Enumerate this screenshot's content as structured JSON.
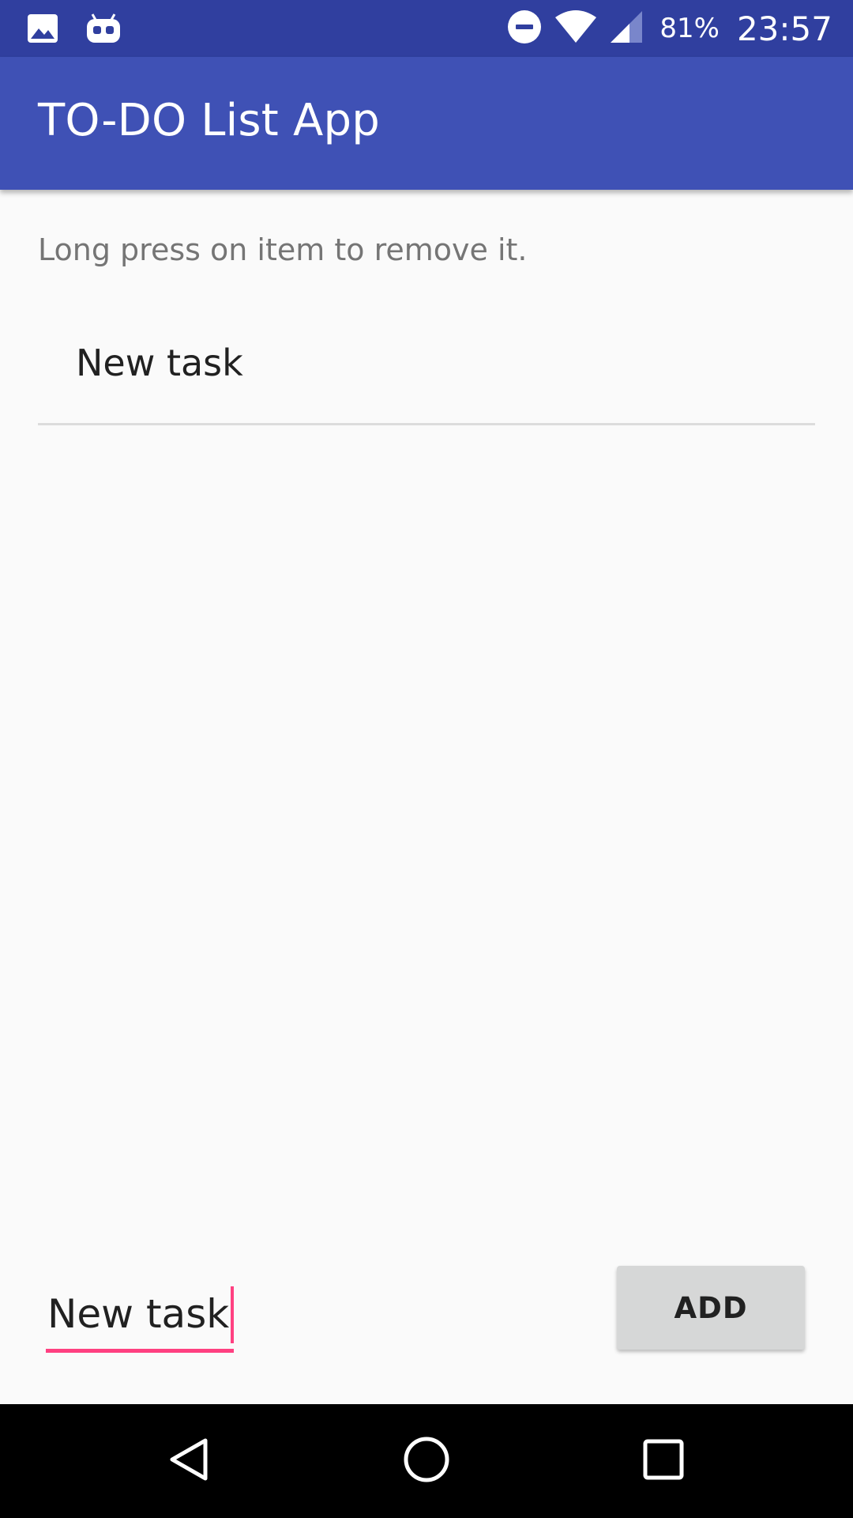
{
  "status_bar": {
    "battery": "81%",
    "time": "23:57",
    "icons": [
      "gallery-notification-icon",
      "android-debug-icon",
      "do-not-disturb-icon",
      "wifi-icon",
      "cell-signal-icon"
    ],
    "background_color": "#303f9f"
  },
  "app_bar": {
    "title": "TO-DO List App",
    "background_color": "#3f51b5"
  },
  "main": {
    "hint": "Long press on item to remove it.",
    "tasks": [
      {
        "label": "New task"
      }
    ]
  },
  "input": {
    "value": "New task",
    "accent_color": "#ff4081"
  },
  "add_button": {
    "label": "ADD"
  },
  "nav_bar": {
    "icons": [
      "back-icon",
      "home-icon",
      "recents-icon"
    ]
  }
}
